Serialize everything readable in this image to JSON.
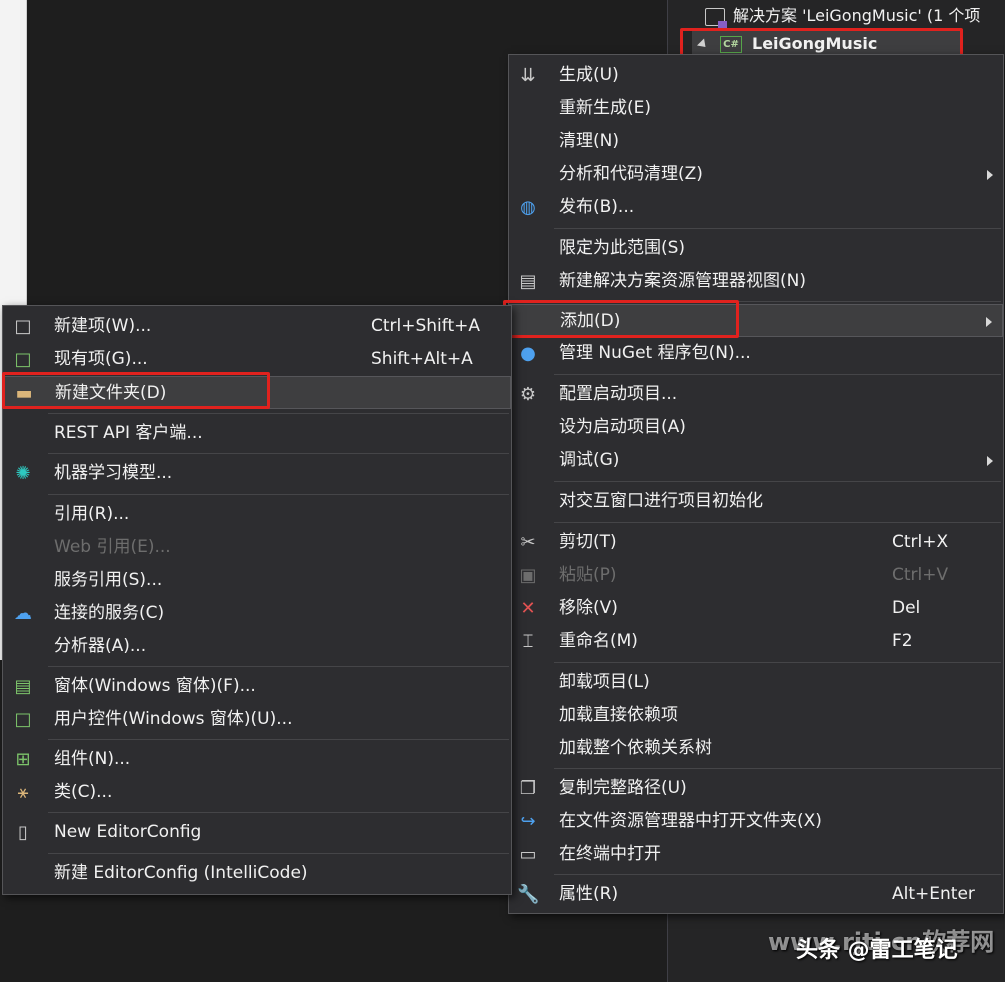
{
  "solution_explorer": {
    "solution_label": "解决方案 'LeiGongMusic' (1 个项",
    "project_label": "LeiGongMusic",
    "project_icon_text": "C#"
  },
  "context_menu": {
    "items": [
      {
        "label": "生成(U)",
        "icon": "build-icon"
      },
      {
        "label": "重新生成(E)"
      },
      {
        "label": "清理(N)"
      },
      {
        "label": "分析和代码清理(Z)",
        "submenu": true
      },
      {
        "label": "发布(B)...",
        "icon": "globe-icon"
      },
      {
        "label": "限定为此范围(S)"
      },
      {
        "label": "新建解决方案资源管理器视图(N)",
        "icon": "new-view-icon"
      },
      {
        "label": "添加(D)",
        "submenu": true,
        "highlighted": true
      },
      {
        "label": "管理 NuGet 程序包(N)...",
        "icon": "nuget-icon"
      },
      {
        "label": "配置启动项目...",
        "icon": "gear-icon"
      },
      {
        "label": "设为启动项目(A)"
      },
      {
        "label": "调试(G)",
        "submenu": true
      },
      {
        "label": "对交互窗口进行项目初始化"
      },
      {
        "label": "剪切(T)",
        "shortcut": "Ctrl+X",
        "icon": "scissors-icon"
      },
      {
        "label": "粘贴(P)",
        "shortcut": "Ctrl+V",
        "icon": "paste-icon",
        "disabled": true
      },
      {
        "label": "移除(V)",
        "shortcut": "Del",
        "icon": "remove-icon"
      },
      {
        "label": "重命名(M)",
        "shortcut": "F2",
        "icon": "rename-icon"
      },
      {
        "label": "卸载项目(L)"
      },
      {
        "label": "加载直接依赖项"
      },
      {
        "label": "加载整个依赖关系树"
      },
      {
        "label": "复制完整路径(U)",
        "icon": "copy-icon"
      },
      {
        "label": "在文件资源管理器中打开文件夹(X)",
        "icon": "open-folder-icon"
      },
      {
        "label": "在终端中打开",
        "icon": "terminal-icon"
      },
      {
        "label": "属性(R)",
        "shortcut": "Alt+Enter",
        "icon": "wrench-icon"
      }
    ]
  },
  "add_submenu": {
    "items": [
      {
        "label": "新建项(W)...",
        "shortcut": "Ctrl+Shift+A",
        "icon": "new-item-icon"
      },
      {
        "label": "现有项(G)...",
        "shortcut": "Shift+Alt+A",
        "icon": "existing-item-icon"
      },
      {
        "label": "新建文件夹(D)",
        "icon": "new-folder-icon",
        "highlighted": true
      },
      {
        "label": "REST API 客户端..."
      },
      {
        "label": "机器学习模型...",
        "icon": "ml-model-icon"
      },
      {
        "label": "引用(R)..."
      },
      {
        "label": "Web 引用(E)...",
        "disabled": true
      },
      {
        "label": "服务引用(S)..."
      },
      {
        "label": "连接的服务(C)",
        "icon": "connected-service-icon"
      },
      {
        "label": "分析器(A)..."
      },
      {
        "label": "窗体(Windows 窗体)(F)...",
        "icon": "form-icon"
      },
      {
        "label": "用户控件(Windows 窗体)(U)...",
        "icon": "user-control-icon"
      },
      {
        "label": "组件(N)...",
        "icon": "component-icon"
      },
      {
        "label": "类(C)...",
        "icon": "class-icon"
      },
      {
        "label": "New EditorConfig",
        "icon": "file-icon"
      },
      {
        "label": "新建 EditorConfig (IntelliCode)"
      }
    ]
  },
  "watermarks": {
    "site": "www.rjtj.cn软荐网",
    "author": "头条 @雷工笔记"
  },
  "colors": {
    "menu_bg": "#2d2d30",
    "highlight_box": "#e0221e",
    "accent_blue": "#4ea1ef"
  }
}
